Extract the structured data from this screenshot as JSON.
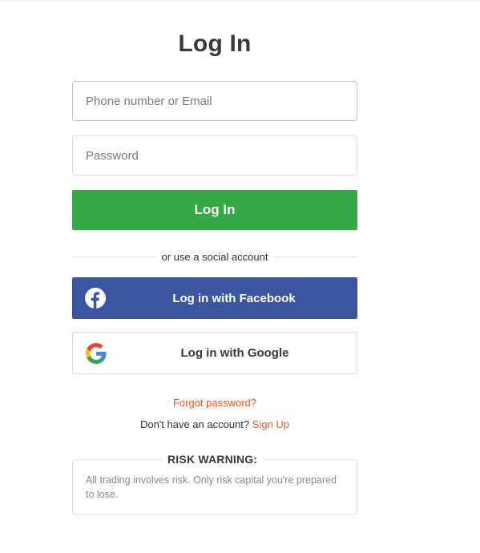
{
  "page": {
    "title": "Log In"
  },
  "form": {
    "phone_placeholder": "Phone number or Email",
    "phone_value": "",
    "password_placeholder": "Password",
    "password_value": "",
    "submit_label": "Log In"
  },
  "social": {
    "divider_text": "or use a social account",
    "facebook_label": "Log in with Facebook",
    "facebook_icon": "facebook-icon",
    "google_label": "Log in with Google",
    "google_icon": "google-icon"
  },
  "links": {
    "forgot_password": "Forgot password?",
    "no_account_text": "Don't have an account?",
    "sign_up": "Sign Up"
  },
  "risk": {
    "title": "RISK WARNING:",
    "text": "All trading involves risk. Only risk capital you're prepared to lose."
  },
  "colors": {
    "login_button": "#35a848",
    "facebook_button": "#3b55a0",
    "link_accent": "#f0571f"
  }
}
